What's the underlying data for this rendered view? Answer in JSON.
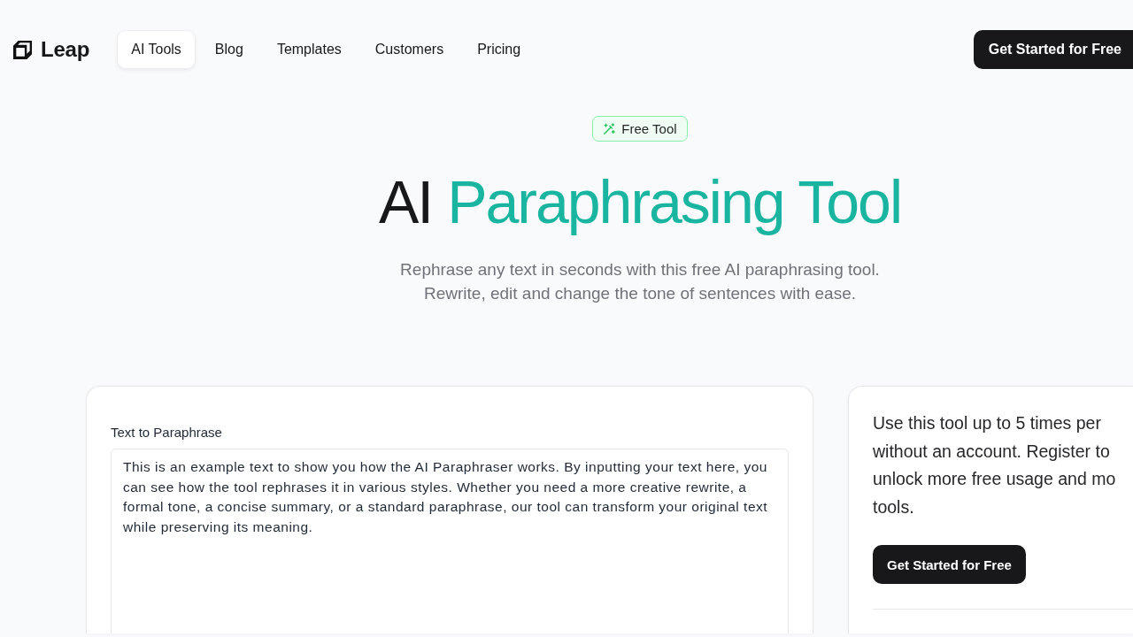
{
  "header": {
    "logo": "Leap",
    "nav": [
      {
        "label": "AI Tools",
        "selected": true
      },
      {
        "label": "Blog",
        "selected": false
      },
      {
        "label": "Templates",
        "selected": false
      },
      {
        "label": "Customers",
        "selected": false
      },
      {
        "label": "Pricing",
        "selected": false
      }
    ],
    "cta": "Get Started for Free"
  },
  "hero": {
    "badge": "Free Tool",
    "title": {
      "plain": "AI",
      "highlight": "Paraphrasing Tool"
    },
    "subtitle": "Rephrase any text in seconds with this free AI paraphrasing tool. Rewrite, edit and change the tone of sentences with ease."
  },
  "input_card": {
    "label": "Text to Paraphrase",
    "value": "This is an example text to show you how the AI Paraphraser works. By inputting your text here, you can see how the tool rephrases it in various styles. Whether you need a more creative rewrite, a formal tone, a concise summary, or a standard paraphrase, our tool can transform your original text while preserving its meaning."
  },
  "usage_card": {
    "text_lines": [
      "Use this tool up to 5 times per",
      "without an account. Register to",
      "unlock more free usage and mo",
      "tools."
    ],
    "button": "Get Started for Free"
  }
}
